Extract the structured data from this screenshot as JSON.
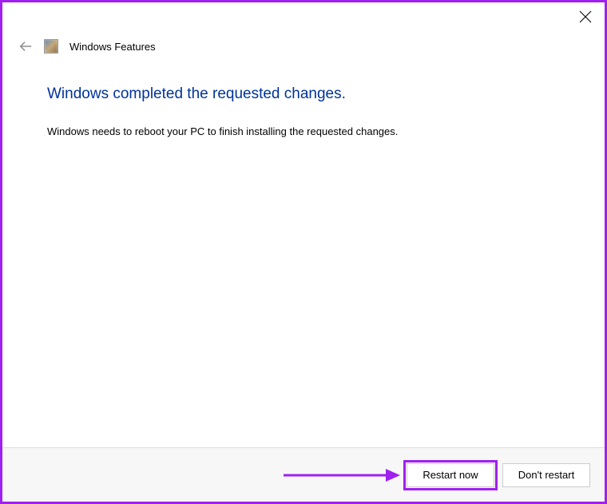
{
  "titlebar": {
    "close_tooltip": "Close"
  },
  "header": {
    "back_tooltip": "Back",
    "title": "Windows Features"
  },
  "content": {
    "heading": "Windows completed the requested changes.",
    "body": "Windows needs to reboot your PC to finish installing the requested changes."
  },
  "footer": {
    "restart_label": "Restart now",
    "dont_restart_label": "Don't restart"
  }
}
